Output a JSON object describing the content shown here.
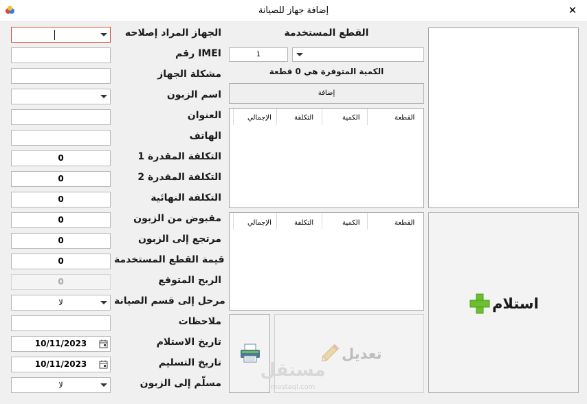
{
  "window": {
    "title": "إضافة جهاز للصيانة",
    "close_glyph": "✕"
  },
  "form": {
    "device_label": "الجهاز المراد إصلاحه",
    "imei_label": "رقم IMEI",
    "problem_label": "مشكلة الجهاز",
    "customer_label": "اسم الزبون",
    "address_label": "العنوان",
    "phone_label": "الهاتف",
    "est_cost1_label": "التكلفة المقدرة 1",
    "est_cost1_value": "0",
    "est_cost2_label": "التكلفة المقدرة 2",
    "est_cost2_value": "0",
    "final_cost_label": "التكلفة النهائية",
    "final_cost_value": "0",
    "received_label": "مقبوض من الزبون",
    "received_value": "0",
    "refund_label": "مرتجع إلى الزبون",
    "refund_value": "0",
    "parts_value_label": "قيمة القطع المستخدمة",
    "parts_value_value": "0",
    "expected_profit_label": "الربح المتوقع",
    "expected_profit_value": "0",
    "to_maintenance_label": "مرحل إلى قسم الصيانة",
    "to_maintenance_value": "لا",
    "notes_label": "ملاحظات",
    "receive_date_label": "تاريخ الاستلام",
    "receive_date_value": "10/11/2023",
    "delivery_date_label": "تاريخ التسليم",
    "delivery_date_value": "10/11/2023",
    "delivered_label": "مسلّم إلى الزبون",
    "delivered_value": "لا"
  },
  "parts": {
    "title": "القطع المستخدمة",
    "quantity_value": "1",
    "available_text": "الكمية المتوفرة هي 0 قطعة",
    "add_label": "إضافة",
    "columns": [
      "القطعة",
      "الكمية",
      "التكلفة",
      "الإجمالي"
    ]
  },
  "actions": {
    "receive_label": "استلام",
    "edit_label": "تعديل"
  },
  "watermark": {
    "text": "مستقل",
    "sub": "mostaql.com"
  },
  "colors": {
    "accent_red": "#d9452f",
    "plus_green": "#6cbf2f"
  }
}
